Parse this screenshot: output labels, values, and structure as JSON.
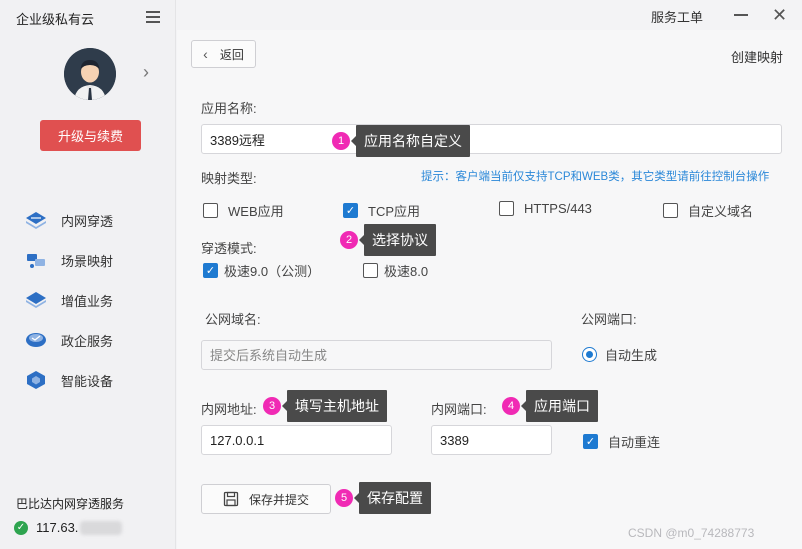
{
  "app": {
    "brand": "企业级私有云",
    "window_title": "服务工单"
  },
  "sidebar": {
    "upgrade_label": "升级与续费",
    "items": [
      {
        "label": "内网穿透",
        "icon": "network-tunnel-icon"
      },
      {
        "label": "场景映射",
        "icon": "scene-mapping-icon"
      },
      {
        "label": "增值业务",
        "icon": "value-added-icon"
      },
      {
        "label": "政企服务",
        "icon": "enterprise-service-icon"
      },
      {
        "label": "智能设备",
        "icon": "smart-device-icon"
      }
    ],
    "service_label": "巴比达内网穿透服务",
    "service_ip": "117.63.",
    "service_status_icon": "check-circle-icon"
  },
  "header": {
    "back_label": "返回",
    "page_title": "创建映射"
  },
  "form": {
    "app_name_label": "应用名称:",
    "app_name_value": "3389远程",
    "mapping_type_label": "映射类型:",
    "hint": "提示：客户端当前仅支持TCP和WEB类，其它类型请前往控制台操作",
    "mapping_types": [
      {
        "label": "WEB应用",
        "checked": false
      },
      {
        "label": "TCP应用",
        "checked": true
      },
      {
        "label": "HTTPS/443",
        "checked": false
      },
      {
        "label": "自定义域名",
        "checked": false
      }
    ],
    "tunnel_mode_label": "穿透模式:",
    "tunnel_modes": [
      {
        "label": "极速9.0（公测）",
        "checked": true
      },
      {
        "label": "极速8.0",
        "checked": false
      }
    ],
    "public_domain_label": "公网域名:",
    "public_domain_placeholder": "提交后系统自动生成",
    "public_port_label": "公网端口:",
    "public_port_option": "自动生成",
    "lan_address_label": "内网地址:",
    "lan_address_value": "127.0.0.1",
    "lan_port_label": "内网端口:",
    "lan_port_value": "3389",
    "auto_reconnect_label": "自动重连",
    "auto_reconnect_checked": true,
    "save_label": "保存并提交"
  },
  "annotations": [
    {
      "num": "1",
      "text": "应用名称自定义"
    },
    {
      "num": "2",
      "text": "选择协议"
    },
    {
      "num": "3",
      "text": "填写主机地址"
    },
    {
      "num": "4",
      "text": "应用端口"
    },
    {
      "num": "5",
      "text": "保存配置"
    }
  ],
  "watermark": "CSDN @m0_74288773",
  "colors": {
    "accent": "#1e7ad1",
    "upgrade_button": "#e05050",
    "annotation_badge": "#f02ab4",
    "annotation_tip": "#4a4a4a",
    "hint_text": "#2b88d8"
  }
}
